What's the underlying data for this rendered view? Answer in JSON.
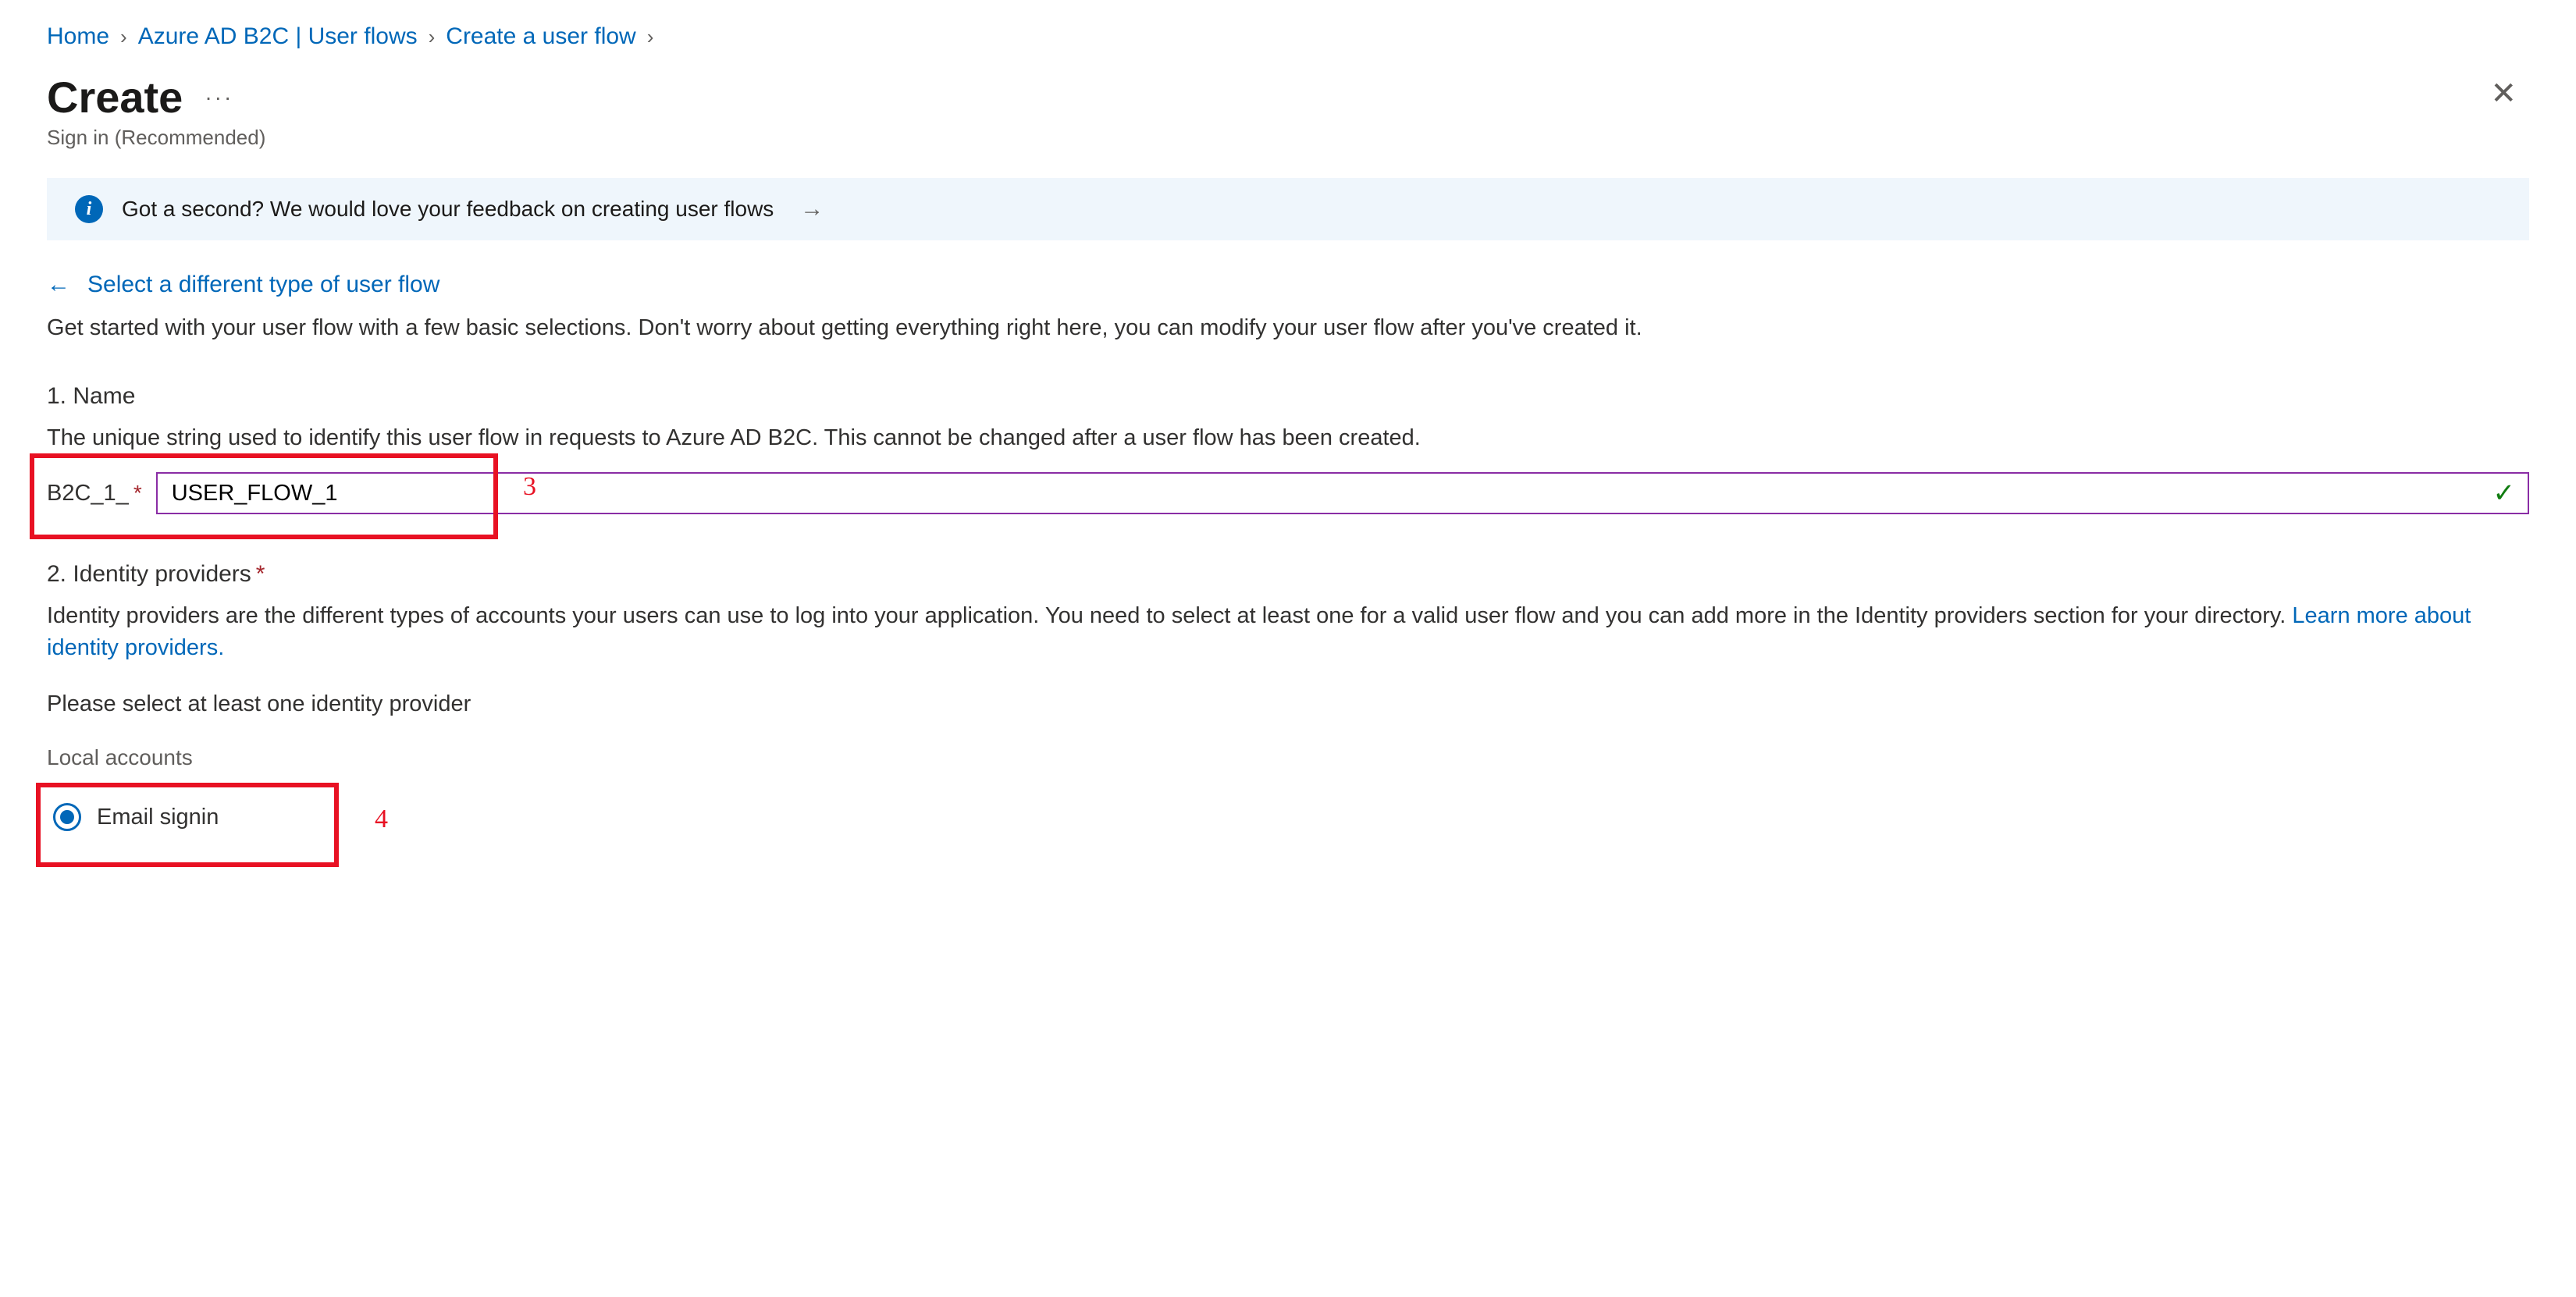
{
  "breadcrumb": {
    "items": [
      "Home",
      "Azure AD B2C | User flows",
      "Create a user flow"
    ]
  },
  "header": {
    "title": "Create",
    "subtitle": "Sign in (Recommended)"
  },
  "banner": {
    "text": "Got a second? We would love your feedback on creating user flows"
  },
  "back_link": "Select a different type of user flow",
  "intro": "Get started with your user flow with a few basic selections. Don't worry about getting everything right here, you can modify your user flow after you've created it.",
  "section_name": {
    "title": "1. Name",
    "desc": "The unique string used to identify this user flow in requests to Azure AD B2C. This cannot be changed after a user flow has been created.",
    "prefix": "B2C_1_",
    "value": "USER_FLOW_1"
  },
  "section_idp": {
    "title": "2. Identity providers",
    "desc_a": "Identity providers are the different types of accounts your users can use to log into your application. You need to select at least one for a valid user flow and you can add more in the Identity providers section for your directory. ",
    "learn_more": "Learn more about identity providers.",
    "prompt": "Please select at least one identity provider",
    "group": "Local accounts",
    "option": "Email signin"
  },
  "annotations": {
    "step3": "3",
    "step4": "4"
  }
}
